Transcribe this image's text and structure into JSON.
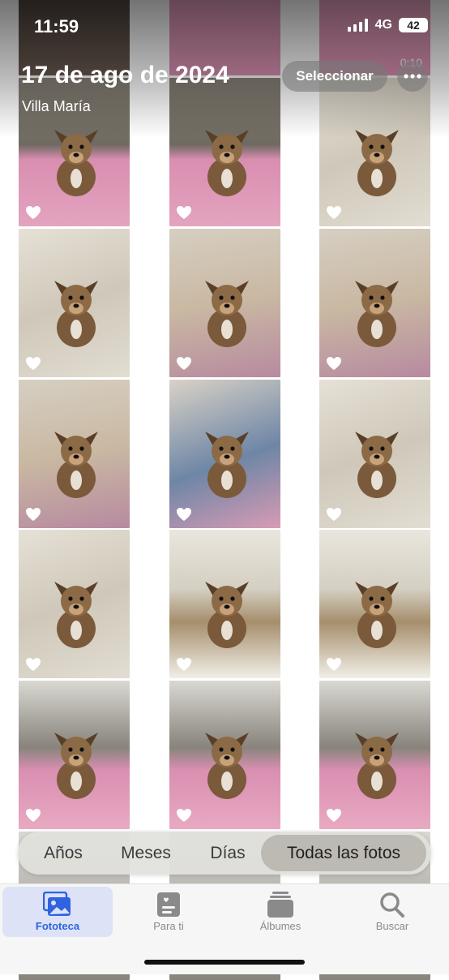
{
  "status": {
    "time": "11:59",
    "network": "4G",
    "battery": "42"
  },
  "header": {
    "date": "17 de ago de 2024",
    "location": "Villa María",
    "select_label": "Seleccionar"
  },
  "segments": {
    "items": [
      "Años",
      "Meses",
      "Días",
      "Todas las fotos"
    ],
    "selected": "Todas las fotos"
  },
  "tabs": [
    {
      "label": "Fototeca",
      "icon": "photo-library-icon",
      "active": true
    },
    {
      "label": "Para ti",
      "icon": "for-you-icon",
      "active": false
    },
    {
      "label": "Álbumes",
      "icon": "albums-icon",
      "active": false
    },
    {
      "label": "Buscar",
      "icon": "search-icon",
      "active": false
    }
  ],
  "partial_video": {
    "duration": "0:10"
  },
  "colors": {
    "accent": "#2f63e0",
    "tab_active_bg": "#dde2f7",
    "pink_blanket": "#e6a1bb",
    "tile_floor": "#d8d2c6"
  },
  "photos": [
    {
      "scene": "pink-blanket-sofa",
      "favorite": true
    },
    {
      "scene": "pink-blanket-sofa",
      "favorite": true
    },
    {
      "scene": "tile-floor",
      "favorite": true
    },
    {
      "scene": "tile-floor",
      "favorite": true
    },
    {
      "scene": "closeup",
      "favorite": true
    },
    {
      "scene": "closeup",
      "favorite": true
    },
    {
      "scene": "closeup",
      "favorite": true
    },
    {
      "scene": "jeans-lap",
      "favorite": true
    },
    {
      "scene": "tile-floor",
      "favorite": true
    },
    {
      "scene": "tile-floor",
      "favorite": true
    },
    {
      "scene": "living-room",
      "favorite": true
    },
    {
      "scene": "living-room",
      "favorite": true
    },
    {
      "scene": "sofa-toy",
      "favorite": true
    },
    {
      "scene": "sofa-toy",
      "favorite": true
    },
    {
      "scene": "sofa-toy",
      "favorite": true
    }
  ]
}
